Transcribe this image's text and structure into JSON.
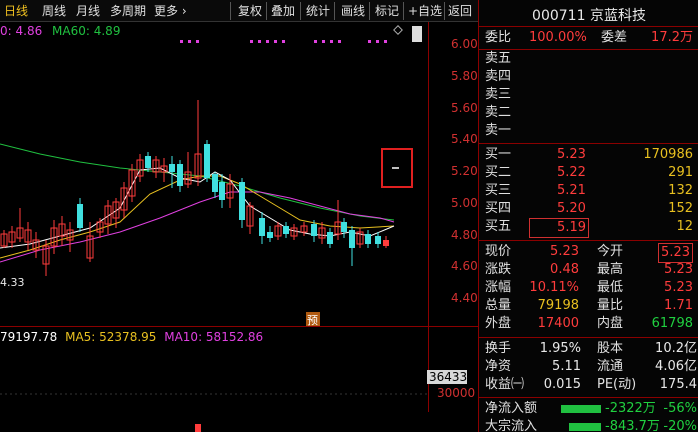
{
  "toolbar": {
    "left": [
      "日线",
      "周线",
      "月线",
      "多周期",
      "更多 ›"
    ],
    "right": [
      "复权",
      "叠加",
      "统计",
      "画线",
      "标记",
      "+自选",
      "返回"
    ]
  },
  "ma": {
    "ma_partial": "0: 4.86",
    "ma60": "MA60: 4.89"
  },
  "price_axis": [
    "6.00",
    "5.80",
    "5.60",
    "5.40",
    "5.20",
    "5.00",
    "4.80",
    "4.60",
    "4.40"
  ],
  "chart_labels": {
    "low_marker": "4.33",
    "event_marker": "预"
  },
  "volume": {
    "vol": "79197.78",
    "ma5": "MA5: 52378.95",
    "ma10": "MA10: 58152.86",
    "current": "36433",
    "axis_30000": "30000"
  },
  "stock": {
    "code_name": "000711 京蓝科技",
    "webi_label": "委比",
    "webi_value": "100.00%",
    "weicha_label": "委差",
    "weicha_value": "17.2万",
    "asks": [
      {
        "label": "卖五"
      },
      {
        "label": "卖四"
      },
      {
        "label": "卖三"
      },
      {
        "label": "卖二"
      },
      {
        "label": "卖一"
      }
    ],
    "bids": [
      {
        "label": "买一",
        "price": "5.23",
        "vol": "170986"
      },
      {
        "label": "买二",
        "price": "5.22",
        "vol": "291"
      },
      {
        "label": "买三",
        "price": "5.21",
        "vol": "132"
      },
      {
        "label": "买四",
        "price": "5.20",
        "vol": "152"
      },
      {
        "label": "买五",
        "price": "5.19",
        "vol": "12"
      }
    ],
    "quote": [
      {
        "l1": "现价",
        "v1": "5.23",
        "c1": "red",
        "l2": "今开",
        "v2": "5.23",
        "c2": "red",
        "box2": true
      },
      {
        "l1": "涨跌",
        "v1": "0.48",
        "c1": "red",
        "l2": "最高",
        "v2": "5.23",
        "c2": "red"
      },
      {
        "l1": "涨幅",
        "v1": "10.11%",
        "c1": "red",
        "l2": "最低",
        "v2": "5.23",
        "c2": "red"
      },
      {
        "l1": "总量",
        "v1": "79198",
        "c1": "yel",
        "l2": "量比",
        "v2": "1.71",
        "c2": "red"
      },
      {
        "l1": "外盘",
        "v1": "17400",
        "c1": "red",
        "l2": "内盘",
        "v2": "61798",
        "c2": "grn"
      }
    ],
    "fund": [
      {
        "l1": "换手",
        "v1": "1.95%",
        "l2": "股本",
        "v2": "10.2亿"
      },
      {
        "l1": "净资",
        "v1": "5.11",
        "l2": "流通",
        "v2": "4.06亿"
      },
      {
        "l1": "收益㈠",
        "v1": "0.015",
        "l2": "PE(动)",
        "v2": "175.4"
      }
    ],
    "flow": [
      {
        "label": "净流入额",
        "value": "-2322万",
        "pct": "-56%"
      },
      {
        "label": "大宗流入",
        "value": "-843.7万",
        "pct": "-20%"
      }
    ]
  },
  "colors": {
    "up": "#ff3c3c",
    "down": "#40e0e0",
    "ma5": "#ffffff",
    "ma10": "#e8c020",
    "ma20": "#e040e0",
    "ma60": "#20c040"
  }
}
